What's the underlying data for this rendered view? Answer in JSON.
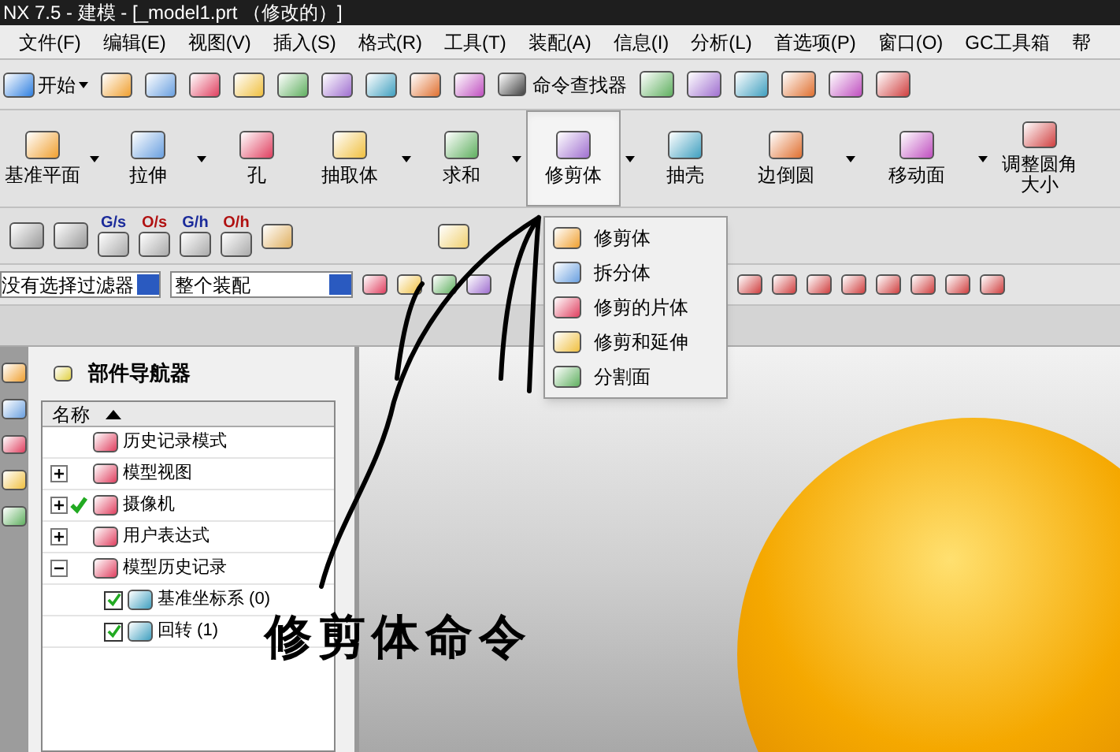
{
  "window": {
    "title": "NX 7.5 - 建模 - [_model1.prt （修改的）]"
  },
  "menu_bar": [
    "文件(F)",
    "编辑(E)",
    "视图(V)",
    "插入(S)",
    "格式(R)",
    "工具(T)",
    "装配(A)",
    "信息(I)",
    "分析(L)",
    "首选项(P)",
    "窗口(O)",
    "GC工具箱",
    "帮"
  ],
  "standard_toolbar": {
    "start": "开始",
    "command_finder": "命令查找器"
  },
  "feature_toolbar": [
    {
      "label": "基准平面",
      "pressed": false,
      "has_menu": true
    },
    {
      "label": "拉伸",
      "pressed": false,
      "has_menu": true
    },
    {
      "label": "孔",
      "pressed": false,
      "has_menu": false
    },
    {
      "label": "抽取体",
      "pressed": false,
      "has_menu": true
    },
    {
      "label": "求和",
      "pressed": false,
      "has_menu": true
    },
    {
      "label": "修剪体",
      "pressed": true,
      "has_menu": true
    },
    {
      "label": "抽壳",
      "pressed": false,
      "has_menu": false
    },
    {
      "label": "边倒圆",
      "pressed": false,
      "has_menu": true
    },
    {
      "label": "移动面",
      "pressed": false,
      "has_menu": true
    },
    {
      "label": "调整圆角大小",
      "pressed": false,
      "has_menu": false
    }
  ],
  "surface_toolbar": [
    "G/s",
    "O/s",
    "G/h",
    "O/h"
  ],
  "selection_bar": {
    "filter": "没有选择过滤器",
    "scope": "整个装配"
  },
  "dropdown_menu": [
    "修剪体",
    "拆分体",
    "修剪的片体",
    "修剪和延伸",
    "分割面"
  ],
  "part_navigator": {
    "title": "部件导航器",
    "column": "名称",
    "items": [
      {
        "label": "历史记录模式",
        "kind": "leaf",
        "checked": false
      },
      {
        "label": "模型视图",
        "kind": "node",
        "expanded": false,
        "checked": false
      },
      {
        "label": "摄像机",
        "kind": "node",
        "expanded": false,
        "checked": true
      },
      {
        "label": "用户表达式",
        "kind": "node",
        "expanded": false,
        "checked": false
      },
      {
        "label": "模型历史记录",
        "kind": "node",
        "expanded": true,
        "checked": false,
        "children": [
          {
            "label": "基准坐标系 (0)",
            "checked": true
          },
          {
            "label": "回转 (1)",
            "checked": true
          }
        ]
      }
    ]
  },
  "annotation": {
    "text": "修剪体命令"
  }
}
